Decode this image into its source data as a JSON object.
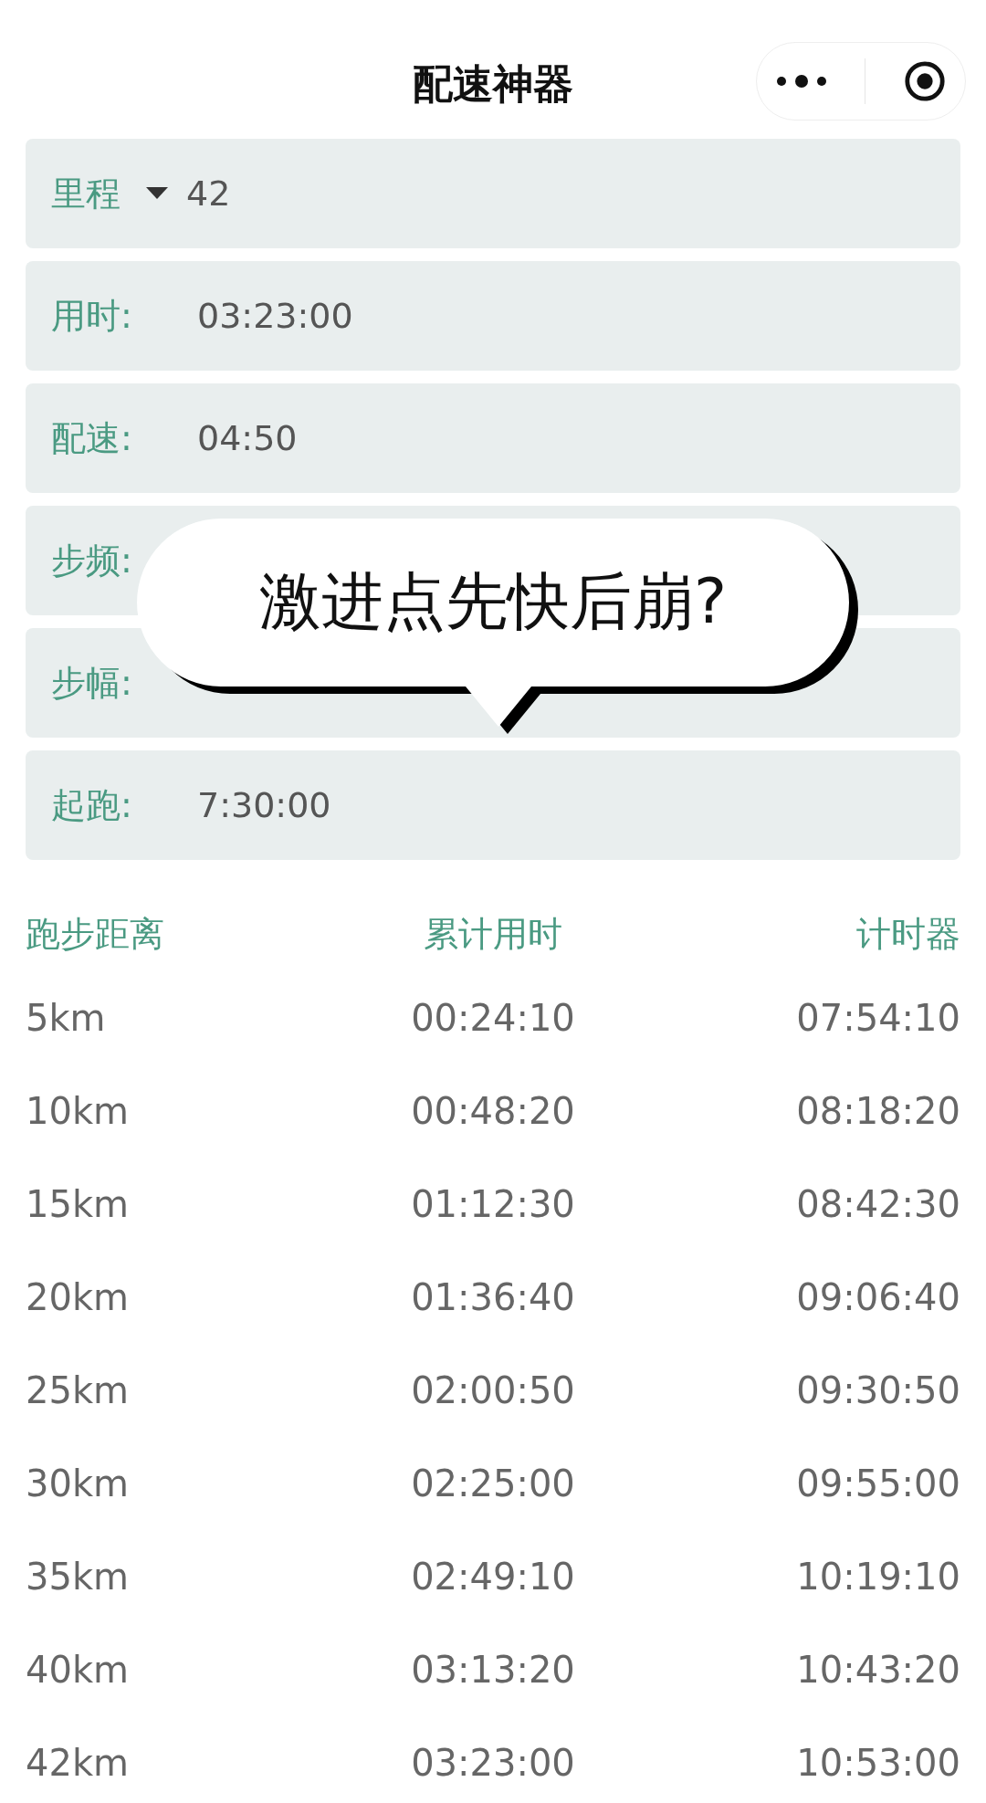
{
  "header": {
    "title": "配速神器"
  },
  "fields": [
    {
      "kind": "dropdown",
      "label": "里程",
      "value": "42"
    },
    {
      "kind": "text",
      "label": "用时:",
      "value": "03:23:00"
    },
    {
      "kind": "text",
      "label": "配速:",
      "value": "04:50"
    },
    {
      "kind": "text",
      "label": "步频:"
    },
    {
      "kind": "text",
      "label": "步幅:"
    },
    {
      "kind": "text",
      "label": "起跑:",
      "value": "7:30:00"
    }
  ],
  "bubble": {
    "text": "激进点先快后崩?"
  },
  "table": {
    "columns": [
      "跑步距离",
      "累计用时",
      "计时器"
    ],
    "rows": [
      [
        "5km",
        "00:24:10",
        "07:54:10"
      ],
      [
        "10km",
        "00:48:20",
        "08:18:20"
      ],
      [
        "15km",
        "01:12:30",
        "08:42:30"
      ],
      [
        "20km",
        "01:36:40",
        "09:06:40"
      ],
      [
        "25km",
        "02:00:50",
        "09:30:50"
      ],
      [
        "30km",
        "02:25:00",
        "09:55:00"
      ],
      [
        "35km",
        "02:49:10",
        "10:19:10"
      ],
      [
        "40km",
        "03:13:20",
        "10:43:20"
      ],
      [
        "42km",
        "03:23:00",
        "10:53:00"
      ]
    ]
  }
}
